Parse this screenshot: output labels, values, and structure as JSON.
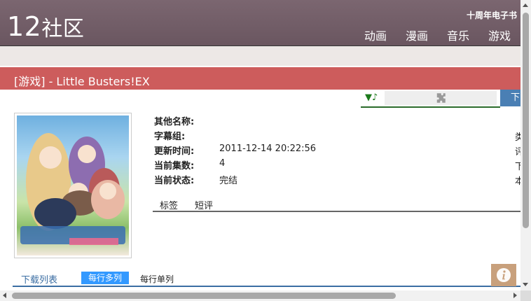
{
  "header": {
    "logo_num": "12",
    "logo_text": "社区",
    "anniversary": "十周年电子书",
    "nav": [
      "动画",
      "漫画",
      "音乐",
      "游戏"
    ]
  },
  "page_title": "[游戏] - Little Busters!EX",
  "player": {
    "icon": "music-note-icon",
    "plugin_icon": "puzzle-icon"
  },
  "download_button_label": "下",
  "info_rows": [
    {
      "label": "其他名称:",
      "value": ""
    },
    {
      "label": "字幕组:",
      "value": ""
    },
    {
      "label": "更新时间:",
      "value": "2011-12-14 20:22:56"
    },
    {
      "label": "当前集数:",
      "value": "4"
    },
    {
      "label": "当前状态:",
      "value": "完结"
    }
  ],
  "right_clip": [
    "类",
    "评",
    "下",
    "本"
  ],
  "tabs": [
    "标签",
    "短评"
  ],
  "download": {
    "list_label": "下载列表",
    "multi_label": "每行多列",
    "single_label": "每行单列"
  },
  "colors": {
    "header": "#6f5b65",
    "title_bar": "#cd5c5c",
    "accent_blue": "#3399ff"
  }
}
